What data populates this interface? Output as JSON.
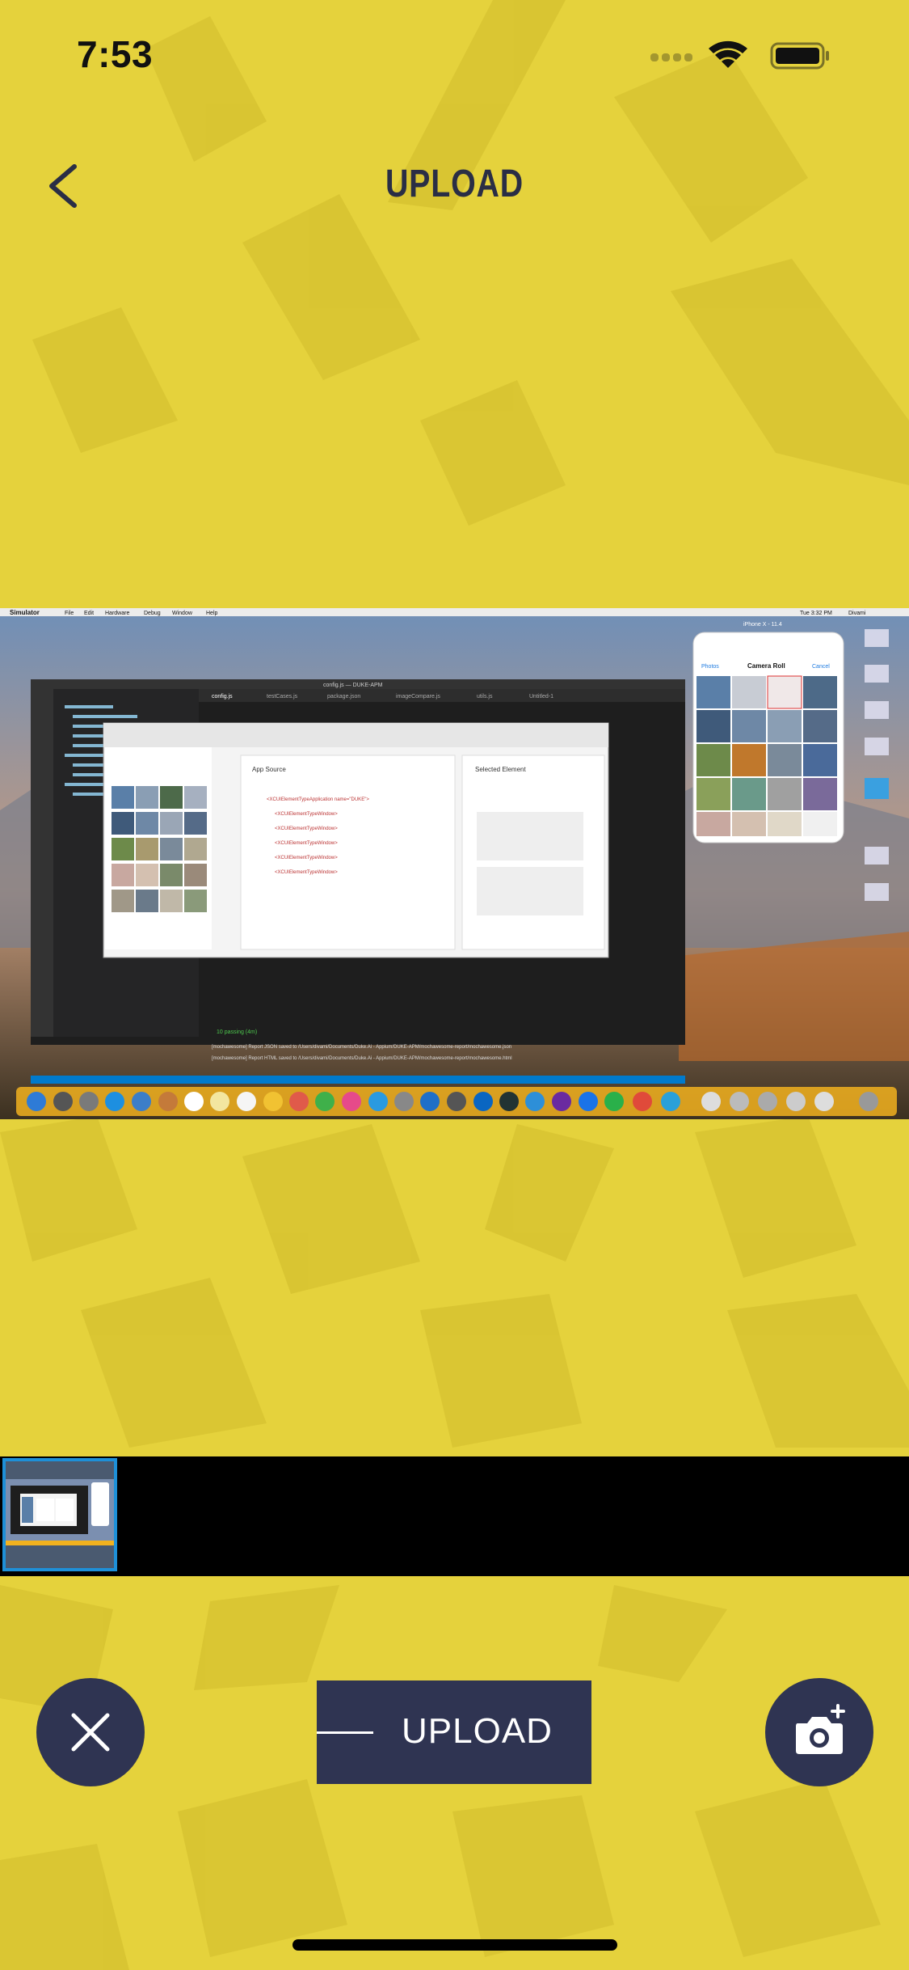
{
  "status_bar": {
    "time": "7:53"
  },
  "nav": {
    "title": "UPLOAD",
    "back_icon": "chevron-left-icon"
  },
  "preview": {
    "menu_bar": {
      "app": "Simulator",
      "items": [
        "File",
        "Edit",
        "Hardware",
        "Debug",
        "Window",
        "Help"
      ],
      "clock": "Tue 3:32 PM",
      "user": "Divami"
    },
    "editor": {
      "window_title": "config.js — DUKE-APM",
      "tabs": [
        "config.js",
        "testCases.js",
        "package.json",
        "imageCompare.js",
        "utils.js",
        "Untitled-1"
      ],
      "panels": {
        "app_source": "App Source",
        "selected_element": "Selected Element"
      },
      "tree_items": [
        "<XCUIElementTypeApplication name=\"DUKE\">",
        "<XCUIElementTypeWindow>",
        "<XCUIElementTypeWindow>",
        "<XCUIElementTypeWindow>",
        "<XCUIElementTypeWindow>",
        "<XCUIElementTypeWindow>"
      ],
      "terminal_lines": [
        "10 passing (4m)",
        "[mochawesome] Report JSON saved to /Users/divami/Documents/Duke.Ai - Appium/DUKE-APM/mochawesome-report/mochawesome.json",
        "[mochawesome] Report HTML saved to /Users/divami/Documents/Duke.Ai - Appium/DUKE-APM/mochawesome-report/mochawesome.html"
      ]
    },
    "simulator": {
      "device": "iPhone X - 11.4",
      "screen_title": "Camera Roll",
      "back_label": "Photos",
      "cancel_label": "Cancel"
    }
  },
  "footer": {
    "upload_label": "UPLOAD",
    "cancel_icon": "close-icon",
    "camera_icon": "camera-add-icon"
  },
  "colors": {
    "background": "#e5d23c",
    "button": "#2f3452",
    "selected_border": "#1e90d8"
  }
}
